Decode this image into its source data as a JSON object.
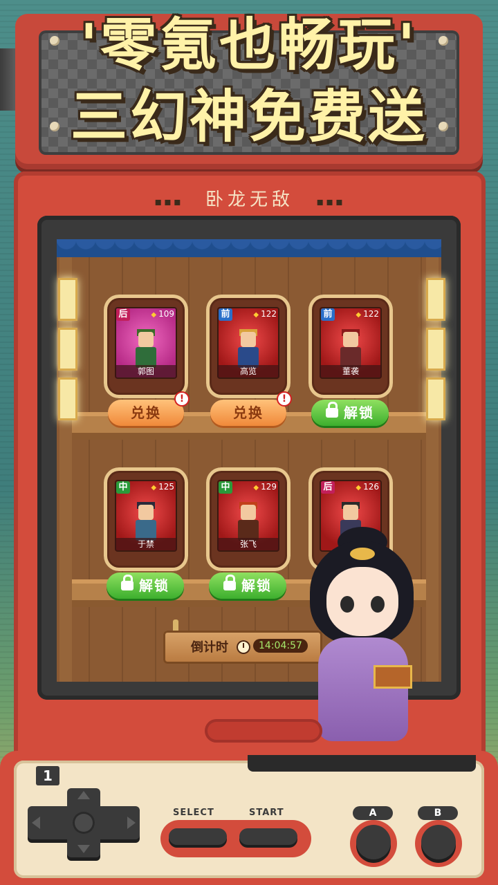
{
  "banner": {
    "line1": "'零氪也畅玩'",
    "line2": "三幻神免费送"
  },
  "cabinet": {
    "title": "卧龙无敌",
    "dots_left": "▪▪▪",
    "dots_right": "▪▪▪"
  },
  "heroes": [
    {
      "name": "郭图",
      "role": "后",
      "power": "109",
      "frame": "pink",
      "action": "兑换",
      "action_type": "exchange",
      "has_alert": true
    },
    {
      "name": "高览",
      "role": "前",
      "power": "122",
      "frame": "red",
      "action": "兑换",
      "action_type": "exchange",
      "has_alert": true
    },
    {
      "name": "董袭",
      "role": "前",
      "power": "122",
      "frame": "red",
      "action": "解锁",
      "action_type": "unlock",
      "has_alert": false
    },
    {
      "name": "于禁",
      "role": "中",
      "power": "125",
      "frame": "red",
      "action": "解锁",
      "action_type": "unlock",
      "has_alert": false
    },
    {
      "name": "张飞",
      "role": "中",
      "power": "129",
      "frame": "red",
      "action": "解锁",
      "action_type": "unlock",
      "has_alert": false
    },
    {
      "name": "",
      "role": "后",
      "power": "126",
      "frame": "red",
      "action": "",
      "action_type": "hidden",
      "has_alert": false
    }
  ],
  "alert_mark": "!",
  "countdown": {
    "label": "倒计时",
    "time": "14:04:57"
  },
  "console": {
    "player": "1",
    "select_label": "SELECT",
    "start_label": "START",
    "a_label": "A",
    "b_label": "B"
  },
  "colors": {
    "cabinet_red": "#d34c3c",
    "title_yellow": "#fff2a8",
    "exchange_orange": "#f0893a",
    "unlock_green": "#3daf2e"
  }
}
